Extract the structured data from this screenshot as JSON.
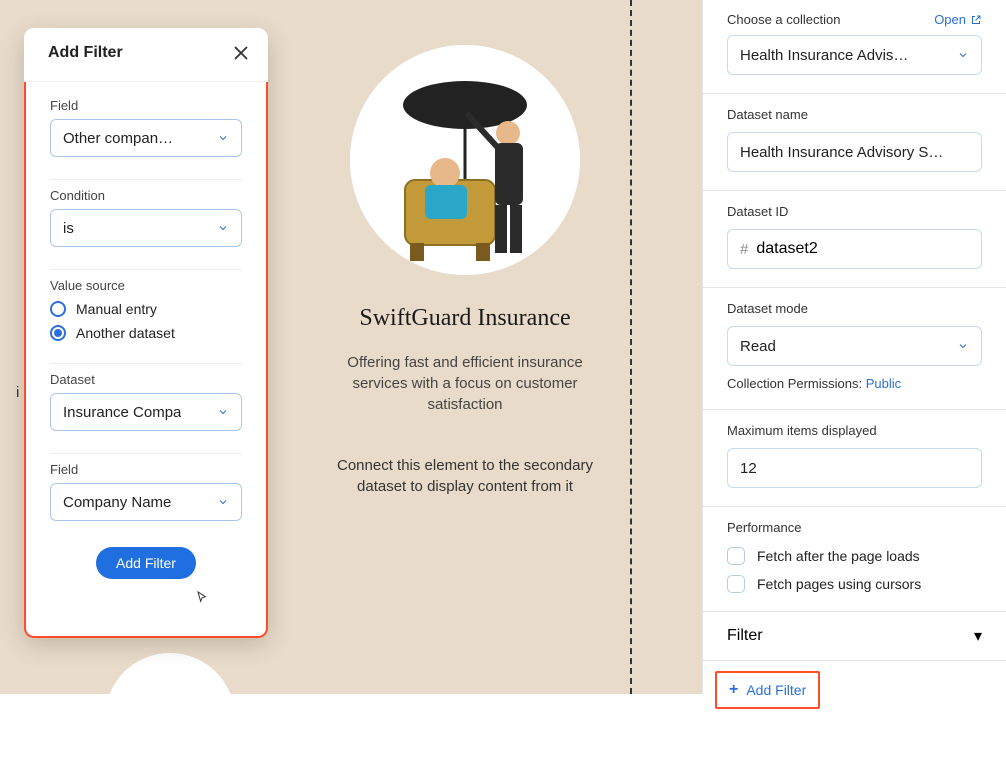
{
  "canvas": {
    "left_hint": "i",
    "card": {
      "title": "SwiftGuard Insurance",
      "desc": "Offering fast and efficient insurance services with a focus on customer satisfaction",
      "connect": "Connect this element to the secondary dataset to display content from it"
    }
  },
  "popover": {
    "title": "Add Filter",
    "field_label": "Field",
    "field_value": "Other compan…",
    "condition_label": "Condition",
    "condition_value": "is",
    "value_source_label": "Value source",
    "value_source_options": {
      "manual": "Manual entry",
      "another": "Another dataset"
    },
    "value_source_selected": "another",
    "dataset_label": "Dataset",
    "dataset_value": "Insurance Compa",
    "field2_label": "Field",
    "field2_value": "Company Name",
    "submit": "Add Filter"
  },
  "panel": {
    "collection": {
      "label": "Choose a collection",
      "open": "Open",
      "value": "Health Insurance Advis…"
    },
    "dataset_name": {
      "label": "Dataset name",
      "value": "Health Insurance Advisory S…"
    },
    "dataset_id": {
      "label": "Dataset ID",
      "value": "dataset2"
    },
    "mode": {
      "label": "Dataset mode",
      "value": "Read",
      "perm_label": "Collection Permissions:",
      "perm_value": "Public"
    },
    "max_items": {
      "label": "Maximum items displayed",
      "value": "12"
    },
    "performance": {
      "label": "Performance",
      "fetch_after": "Fetch after the page loads",
      "fetch_cursor": "Fetch pages using cursors"
    },
    "filter": {
      "header": "Filter",
      "add": "Add Filter"
    }
  }
}
